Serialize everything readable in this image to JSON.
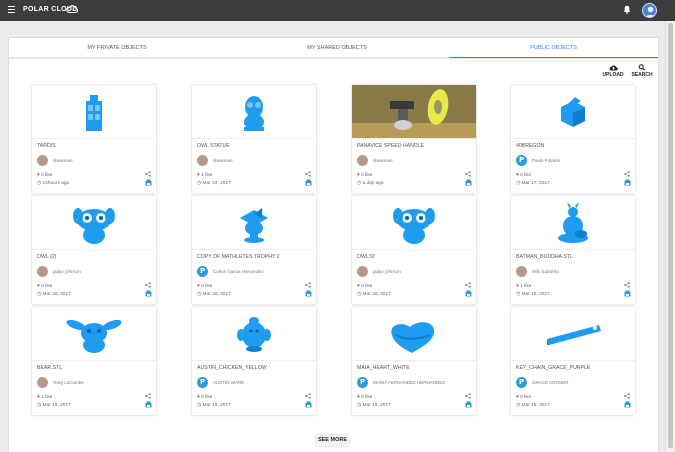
{
  "app": {
    "brand": "POLAR CLOUD",
    "accent_color": "#3b82f6",
    "model_color": "#1f9bf0",
    "topbar_color": "#3c3c3c"
  },
  "tabs": [
    {
      "label": "MY PRIVATE OBJECTS",
      "active": false
    },
    {
      "label": "MY SHARED OBJECTS",
      "active": false
    },
    {
      "label": "PUBLIC OBJECTS",
      "active": true
    }
  ],
  "toolbar": {
    "upload_label": "UPLOAD",
    "search_label": "SEARCH"
  },
  "cards": [
    {
      "title": "TARDIS",
      "user": "dnewman",
      "likes": "0 like",
      "date": "15hours ago",
      "avatar": "photo",
      "model": "tardis"
    },
    {
      "title": "OWL STATUE",
      "user": "dnewman",
      "likes": "1 like",
      "date": "Mar 23, 2017",
      "avatar": "photo",
      "model": "owl-statue"
    },
    {
      "title": "PANAVICE SPEED HANDLE",
      "user": "dnewman",
      "likes": "0 like",
      "date": "a day ago",
      "avatar": "photo",
      "model": "photo"
    },
    {
      "title": "40BREGON",
      "user": "Paulo Polarek",
      "likes": "0 like",
      "date": "Mar 17, 2017",
      "avatar": "p",
      "model": "cube"
    },
    {
      "title": "OWL (2)",
      "user": "jadyn johnson",
      "likes": "0 like",
      "date": "Mar 16, 2017",
      "avatar": "photo",
      "model": "owl-cartoon"
    },
    {
      "title": "COPY OF MATHLETES TROPHY 2",
      "user": "Carlos Garcia Hernandez",
      "likes": "0 like",
      "date": "Mar 16, 2017",
      "avatar": "p",
      "model": "trophy"
    },
    {
      "title": "OWL32",
      "user": "jadyn johnson",
      "likes": "0 like",
      "date": "Mar 16, 2017",
      "avatar": "photo",
      "model": "owl-cartoon"
    },
    {
      "title": "BATMAN_BUDDHA.STL",
      "user": "Milo Eubanks",
      "likes": "1 like",
      "date": "Mar 16, 2017",
      "avatar": "photo",
      "model": "buddha"
    },
    {
      "title": "BEAR.STL",
      "user": "Greg LaCombe",
      "likes": "1 like",
      "date": "Mar 16, 2017",
      "avatar": "photo",
      "model": "bear"
    },
    {
      "title": "AUSTIN_CHICKEN_YELLOW",
      "user": "AUSTIN WARE",
      "likes": "0 like",
      "date": "Mar 16, 2017",
      "avatar": "p",
      "model": "chicken"
    },
    {
      "title": "MAIA_HEART_WHITE",
      "user": "MARIA FERNANDEZ HERNANDEZ",
      "likes": "0 like",
      "date": "Mar 16, 2017",
      "avatar": "p",
      "model": "heart"
    },
    {
      "title": "KEY_CHAIN_GRACE_PURPLE",
      "user": "GRACE KRONER",
      "likes": "0 like",
      "date": "Mar 16, 2017",
      "avatar": "p",
      "model": "keychain"
    }
  ],
  "see_more_label": "SEE MORE"
}
